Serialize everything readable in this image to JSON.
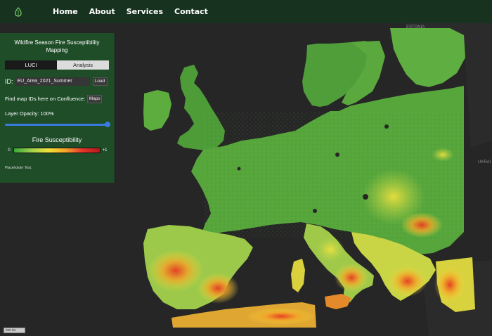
{
  "nav": {
    "items": [
      {
        "label": "Home"
      },
      {
        "label": "About"
      },
      {
        "label": "Services"
      },
      {
        "label": "Contact"
      }
    ]
  },
  "panel": {
    "title": "Wildfire Season Fire Susceptibility Mapping",
    "tabs": [
      {
        "label": "LUCI",
        "active": true
      },
      {
        "label": "Analysis",
        "active": false
      }
    ],
    "id_label": "ID:",
    "id_value": "EU_Area_2021_Summer",
    "load_label": "Load",
    "confluence_text": "Find map IDs here on Confluence:",
    "maps_label": "Maps",
    "opacity_text": "Layer Opacity: 100%",
    "opacity_value": 1.0,
    "legend": {
      "title": "Fire Susceptibility",
      "min_label": "0",
      "max_label": "+1"
    },
    "placeholder": "Placeholder Text."
  },
  "map": {
    "labels": {
      "estonia": "ESTONIA",
      "ukraine": "UKRAI"
    },
    "scale_text": "200 km"
  },
  "colors": {
    "navbar": "#16341e",
    "panel": "#1e4d28",
    "accent": "#3a7be0",
    "basemap": "#262626"
  }
}
